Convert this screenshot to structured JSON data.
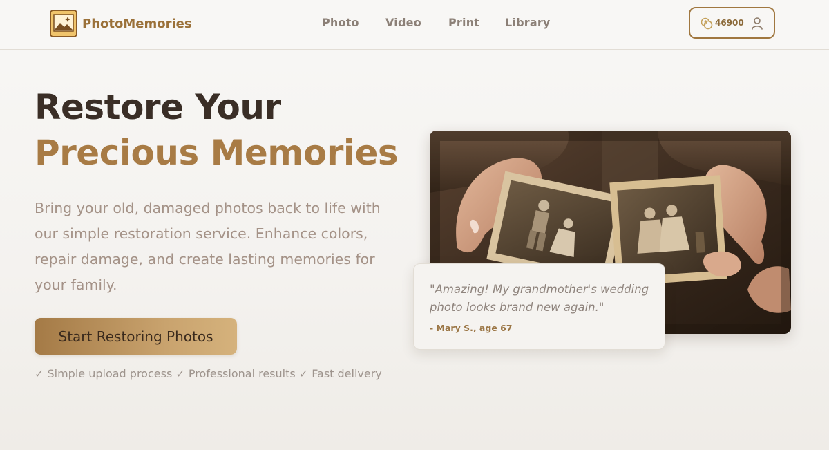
{
  "brand": {
    "name": "PhotoMemories",
    "icon": "photo-frame-icon"
  },
  "nav": {
    "items": [
      "Photo",
      "Video",
      "Print",
      "Library"
    ]
  },
  "account": {
    "coins": "46900",
    "coin_icon": "coins-icon",
    "user_icon": "user-icon"
  },
  "hero": {
    "title_line1": "Restore Your",
    "title_line2": "Precious Memories",
    "description": "Bring your old, damaged photos back to life with our simple restoration service. Enhance colors, repair damage, and create lasting memories for your family.",
    "cta_label": "Start Restoring Photos",
    "features": "✓ Simple upload process ✓ Professional results ✓ Fast delivery"
  },
  "testimonial": {
    "quote": "\"Amazing! My grandmother's wedding photo looks brand new again.\"",
    "author": "- Mary S., age 67"
  },
  "colors": {
    "accent": "#a87b45",
    "dark_text": "#3a2e26",
    "muted_text": "#a49287"
  }
}
